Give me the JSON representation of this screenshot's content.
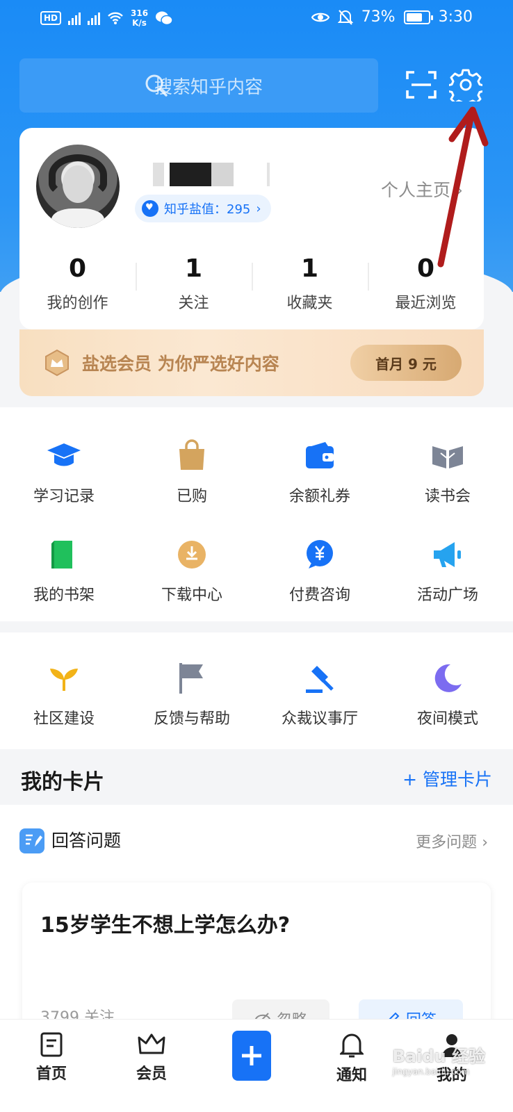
{
  "status_bar": {
    "network_speed": "316",
    "network_unit": "K/s",
    "battery": "73%",
    "time": "3:30",
    "battery_level": 0.73
  },
  "header": {
    "search_placeholder": "搜索知乎内容"
  },
  "profile": {
    "yanzhi": "知乎盐值：295",
    "homepage_link": "个人主页",
    "stats": [
      {
        "num": "0",
        "label": "我的创作"
      },
      {
        "num": "1",
        "label": "关注"
      },
      {
        "num": "1",
        "label": "收藏夹"
      },
      {
        "num": "0",
        "label": "最近浏览"
      }
    ]
  },
  "vip": {
    "text": "盐选会员 为你严选好内容",
    "button": "首月 9 元"
  },
  "grid1": [
    {
      "label": "学习记录",
      "icon": "graduation-cap-icon"
    },
    {
      "label": "已购",
      "icon": "shopping-bag-icon"
    },
    {
      "label": "余额礼券",
      "icon": "wallet-icon"
    },
    {
      "label": "读书会",
      "icon": "open-book-icon"
    },
    {
      "label": "我的书架",
      "icon": "bookshelf-icon"
    },
    {
      "label": "下载中心",
      "icon": "download-icon"
    },
    {
      "label": "付费咨询",
      "icon": "yuan-bubble-icon"
    },
    {
      "label": "活动广场",
      "icon": "megaphone-icon"
    }
  ],
  "grid2": [
    {
      "label": "社区建设",
      "icon": "sprout-icon"
    },
    {
      "label": "反馈与帮助",
      "icon": "flag-icon"
    },
    {
      "label": "众裁议事厅",
      "icon": "gavel-icon"
    },
    {
      "label": "夜间模式",
      "icon": "moon-icon"
    }
  ],
  "cards": {
    "title": "我的卡片",
    "manage": "+ 管理卡片"
  },
  "answer": {
    "title": "回答问题",
    "more": "更多问题",
    "question": "15岁学生不想上学怎么办?",
    "followers": "3799 关注",
    "ignore": "忽略",
    "answer": "回答"
  },
  "bottom_nav": {
    "home": "首页",
    "vip": "会员",
    "notify": "通知",
    "me": "我的"
  },
  "watermark": {
    "brand": "Baidu 经验",
    "url": "jingyan.baidu.com"
  },
  "colors": {
    "brand_blue": "#1772f6",
    "header_blue": "#1a8bf6",
    "annotation_red": "#b01c1c"
  }
}
